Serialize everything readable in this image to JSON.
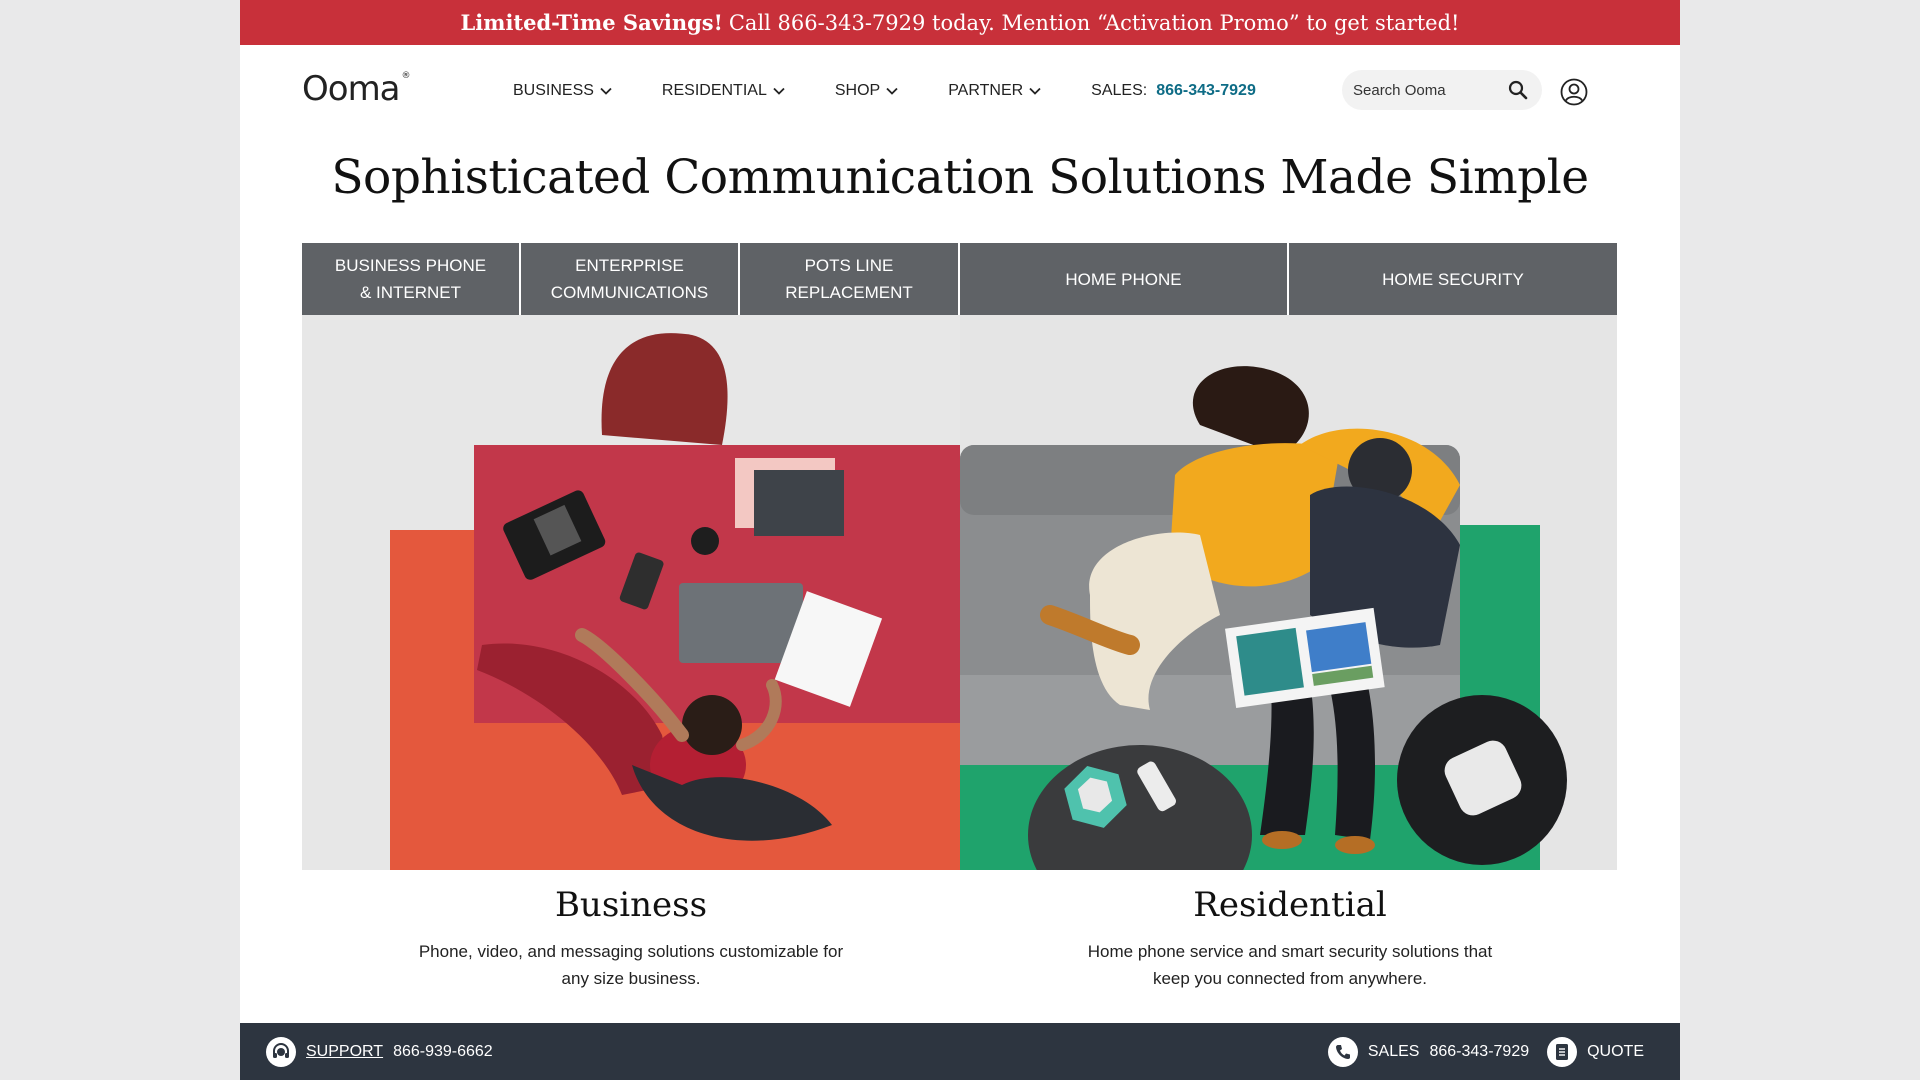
{
  "promo": {
    "bold": "Limited-Time Savings!",
    "text": "Call 866-343-7929 today. Mention “Activation Promo” to get started!"
  },
  "header": {
    "logo": "Ooma",
    "logo_mark": "®",
    "nav": [
      {
        "label": "BUSINESS"
      },
      {
        "label": "RESIDENTIAL"
      },
      {
        "label": "SHOP"
      },
      {
        "label": "PARTNER"
      }
    ],
    "sales_label": "SALES:",
    "sales_number": "866-343-7929",
    "search_placeholder": "Search Ooma"
  },
  "headline": "Sophisticated Communication Solutions Made Simple",
  "tabs": [
    {
      "line1": "BUSINESS PHONE",
      "line2": "& INTERNET"
    },
    {
      "line1": "ENTERPRISE",
      "line2": "COMMUNICATIONS"
    },
    {
      "line1": "POTS LINE",
      "line2": "REPLACEMENT"
    },
    {
      "line1": "HOME PHONE",
      "line2": ""
    },
    {
      "line1": "HOME SECURITY",
      "line2": ""
    }
  ],
  "business": {
    "title": "Business",
    "desc_line1": "Phone, video, and messaging solutions customizable for",
    "desc_line2": "any size business."
  },
  "residential": {
    "title": "Residential",
    "desc_line1": "Home phone service and smart security solutions that",
    "desc_line2": "keep you connected from anywhere."
  },
  "footer_bar": {
    "support_label": "SUPPORT",
    "support_number": "866-939-6662",
    "sales_label": "SALES",
    "sales_number": "866-343-7929",
    "quote_label": "QUOTE"
  },
  "colors": {
    "promo_bg": "#c8303a",
    "tab_bg": "#5f6266",
    "accent_link": "#0e6c86",
    "bottom_bar": "#2d3540"
  },
  "icons": [
    "chevron-down-icon",
    "search-icon",
    "user-icon",
    "headset-icon",
    "phone-icon",
    "document-icon"
  ]
}
